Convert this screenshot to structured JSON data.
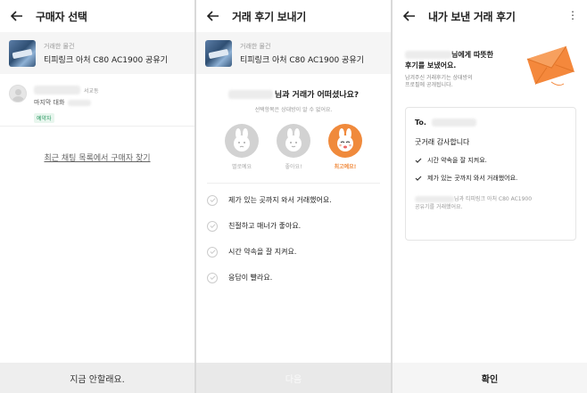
{
  "panel1": {
    "title": "구매자 선택",
    "item": {
      "label": "거래한 물건",
      "name": "티피링크 아처 C80 AC1900 공유기"
    },
    "buyer": {
      "location": "서교동",
      "last_message": "마지막 대화",
      "badge": "예약자"
    },
    "find_link": "최근 채팅 목록에서 구매자 찾기",
    "bottom_button": "지금 안할래요."
  },
  "panel2": {
    "title": "거래 후기 보내기",
    "item": {
      "label": "거래한 물건",
      "name": "티피링크 아처 C80 AC1900 공유기"
    },
    "question": "님과 거래가 어떠셨나요?",
    "sub": "선택항목은 상대방이 알 수 없어요.",
    "faces": [
      {
        "label": "별로예요",
        "state": "gray"
      },
      {
        "label": "좋아요!",
        "state": "gray"
      },
      {
        "label": "최고예요!",
        "state": "selected"
      }
    ],
    "options": [
      "제가 있는 곳까지 와서 거래했어요.",
      "친절하고 매너가 좋아요.",
      "시간 약속을 잘 지켜요.",
      "응답이 빨라요."
    ],
    "bottom_button": "다음"
  },
  "panel3": {
    "title": "내가 보낸 거래 후기",
    "menu_icon": "⋮",
    "message_line1": "님에게 따뜻한",
    "message_line2": "후기를 보냈어요.",
    "sub_line1": "남겨주신 거래후기는 상대방의",
    "sub_line2": "프로필에 공개됩니다.",
    "card": {
      "to": "To.",
      "thanks": "굿거래 감사합니다",
      "items": [
        "시간 약속을 잘 지켜요.",
        "제가 있는 곳까지 와서 거래했어요."
      ],
      "foot_line1": "님과 티피링크 아처 C80 AC1900",
      "foot_line2": "공유기를 거래했어요."
    },
    "bottom_button": "확인"
  },
  "colors": {
    "accent": "#f08a3c",
    "badge": "#2c9a63",
    "envelope": "#f4883c"
  }
}
